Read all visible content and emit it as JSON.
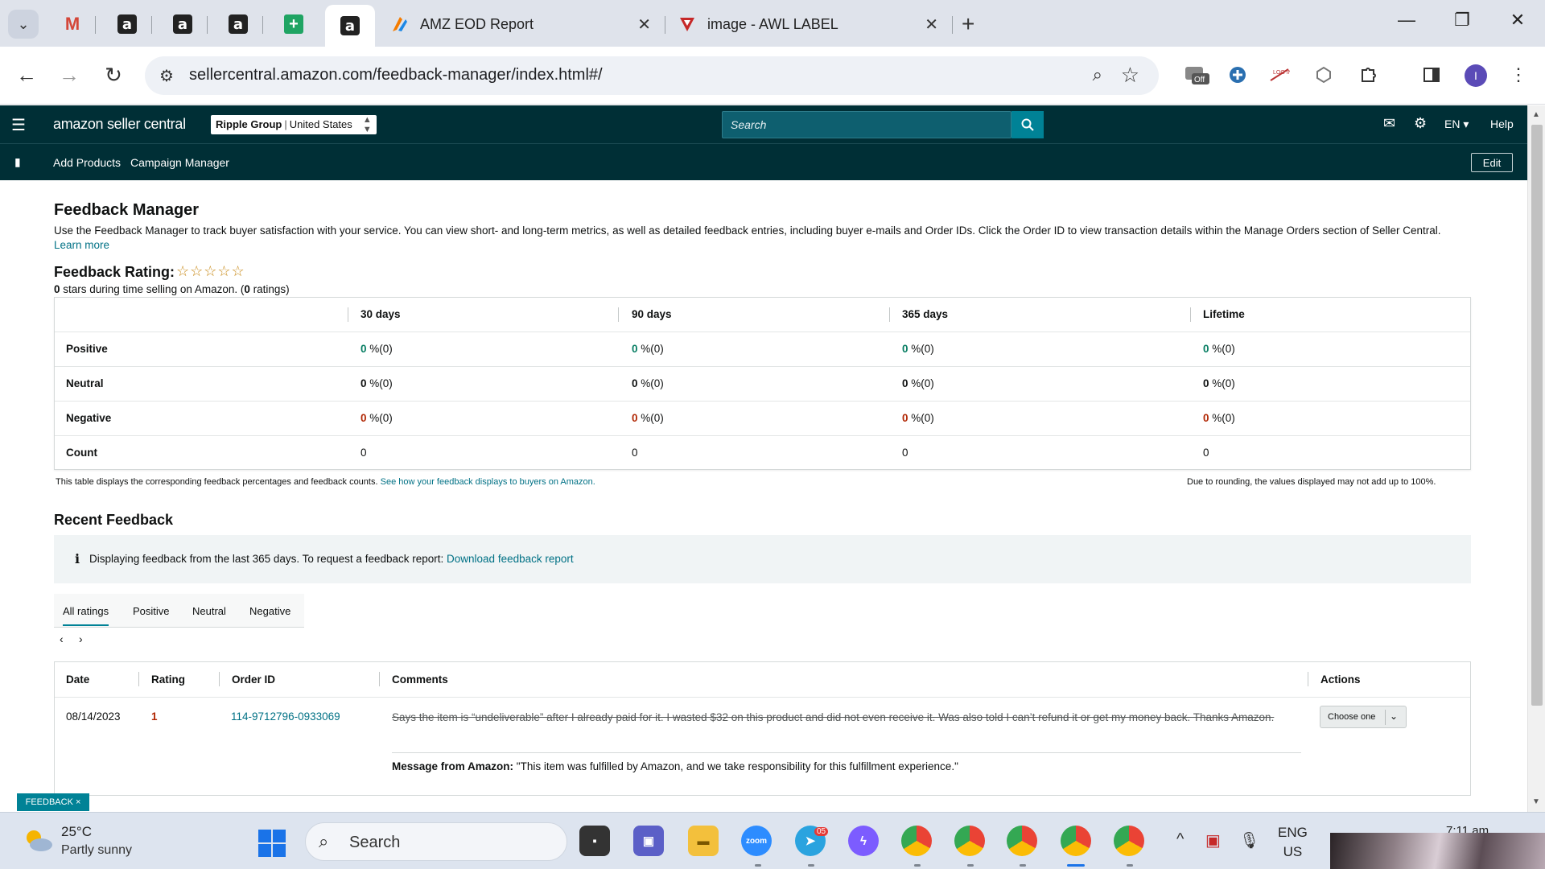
{
  "browser": {
    "tabs": [
      {
        "title": "AMZ EOD Report"
      },
      {
        "title": "image - AWL LABEL"
      }
    ],
    "url": "sellercentral.amazon.com/feedback-manager/index.html#/"
  },
  "header": {
    "logo": "amazon seller central",
    "store": "Ripple Group",
    "marketplace": "United States",
    "search_placeholder": "Search",
    "language": "EN",
    "help": "Help",
    "nav": [
      "Add Products",
      "Campaign Manager"
    ],
    "edit": "Edit"
  },
  "page": {
    "title": "Feedback Manager",
    "description": "Use the Feedback Manager to track buyer satisfaction with your service. You can view short- and long-term metrics, as well as detailed feedback entries, including buyer e-mails and Order IDs. Click the Order ID to view transaction details within the Manage Orders section of Seller Central.",
    "learn_more": "Learn more",
    "rating_title": "Feedback Rating:",
    "stars": "☆☆☆☆☆",
    "rating_stars": "0",
    "rating_sub_mid": " stars during time selling on Amazon. (",
    "rating_count": "0",
    "rating_sub_end": " ratings)"
  },
  "metrics": {
    "columns": [
      "30 days",
      "90 days",
      "365 days",
      "Lifetime"
    ],
    "rows": {
      "positive": {
        "label": "Positive",
        "values": [
          "0",
          "0",
          "0",
          "0"
        ],
        "suffix": " %(0)"
      },
      "neutral": {
        "label": "Neutral",
        "values": [
          "0",
          "0",
          "0",
          "0"
        ],
        "suffix": " %(0)"
      },
      "negative": {
        "label": "Negative",
        "values": [
          "0",
          "0",
          "0",
          "0"
        ],
        "suffix": " %(0)"
      },
      "count": {
        "label": "Count",
        "values": [
          "0",
          "0",
          "0",
          "0"
        ]
      }
    },
    "note_left": "This table displays the corresponding feedback percentages and feedback counts.",
    "note_link": "See how your feedback displays to buyers on Amazon.",
    "note_right": "Due to rounding, the values displayed may not add up to 100%."
  },
  "recent": {
    "title": "Recent Feedback",
    "info_text": "Displaying feedback from the last 365 days. To request a feedback report:",
    "info_link": "Download feedback report",
    "tabs": [
      "All ratings",
      "Positive",
      "Neutral",
      "Negative"
    ],
    "columns": [
      "Date",
      "Rating",
      "Order ID",
      "Comments",
      "Actions"
    ],
    "row": {
      "date": "08/14/2023",
      "rating": "1",
      "order_id": "114-9712796-0933069",
      "comment": "Says the item is “undeliverable” after I already paid for it. I wasted $32 on this product and did not even receive it. Was also told I can’t refund it or get my money back. Thanks Amazon.",
      "message_label": "Message from Amazon:",
      "message": " \"This item was fulfilled by Amazon, and we take responsibility for this fulfillment experience.\"",
      "action": "Choose one"
    },
    "feedback_tag": "FEEDBACK ×"
  },
  "taskbar": {
    "temp": "25°C",
    "weather": "Partly sunny",
    "search": "Search",
    "lang_top": "ENG",
    "lang_bottom": "US",
    "time": "7:11 am",
    "telegram_badge": "05"
  },
  "colors": {
    "header_bg": "#002f36",
    "accent": "#008296",
    "positive": "#067d62",
    "negative": "#b12704"
  }
}
